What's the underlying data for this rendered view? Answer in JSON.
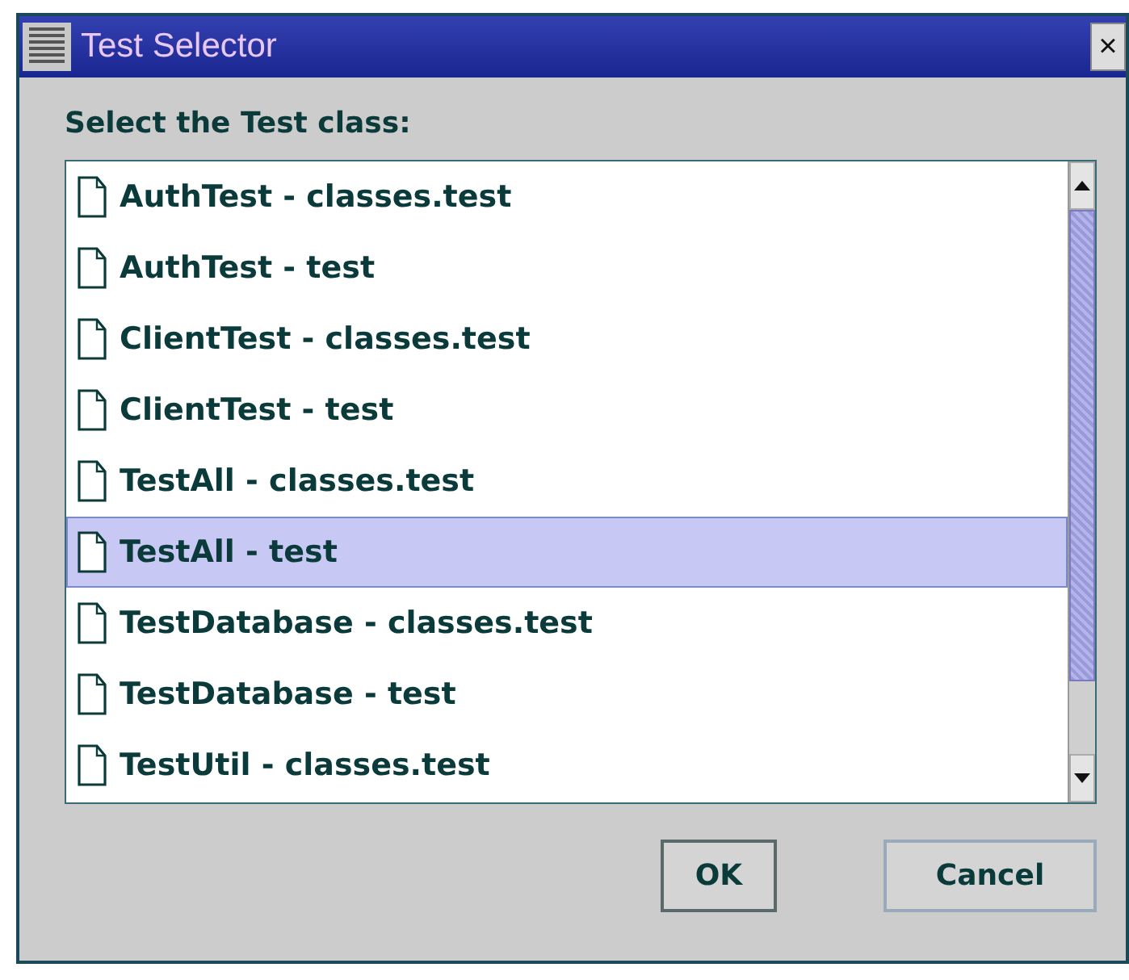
{
  "window": {
    "title": "Test Selector",
    "close": "×"
  },
  "prompt": "Select the Test class:",
  "list": {
    "items": [
      {
        "label": "AuthTest - classes.test",
        "selected": false
      },
      {
        "label": "AuthTest - test",
        "selected": false
      },
      {
        "label": "ClientTest - classes.test",
        "selected": false
      },
      {
        "label": "ClientTest - test",
        "selected": false
      },
      {
        "label": "TestAll - classes.test",
        "selected": false
      },
      {
        "label": "TestAll - test",
        "selected": true
      },
      {
        "label": "TestDatabase - classes.test",
        "selected": false
      },
      {
        "label": "TestDatabase - test",
        "selected": false
      },
      {
        "label": "TestUtil - classes.test",
        "selected": false
      }
    ]
  },
  "buttons": [
    {
      "label": "OK"
    },
    {
      "label": "Cancel"
    }
  ]
}
